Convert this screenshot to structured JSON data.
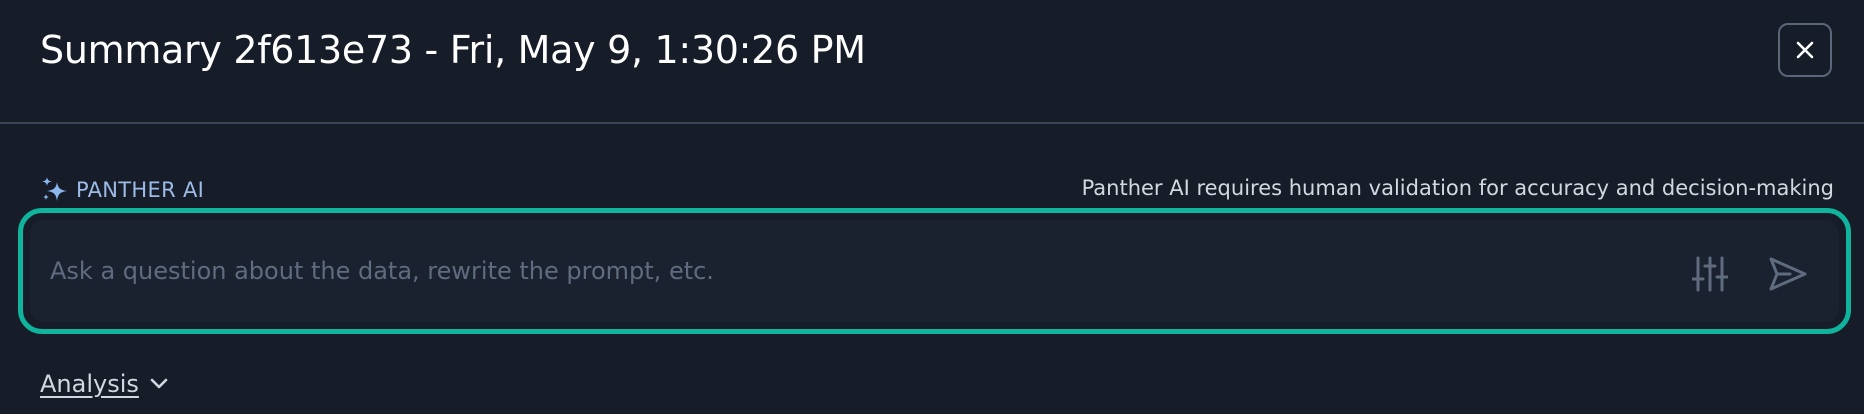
{
  "header": {
    "title": "Summary 2f613e73 - Fri, May 9, 1:30:26 PM",
    "close_icon": "close-icon"
  },
  "ai": {
    "label": "PANTHER AI",
    "icon": "sparkles-icon",
    "disclaimer": "Panther AI requires human validation for accuracy and decision-making"
  },
  "prompt": {
    "value": "",
    "placeholder": "Ask a question about the data, rewrite the prompt, etc.",
    "settings_icon": "sliders-icon",
    "send_icon": "send-icon"
  },
  "analysis": {
    "label": "Analysis",
    "icon": "chevron-down-icon"
  },
  "colors": {
    "background": "#161c28",
    "accent_border": "#10b39c",
    "ai_label": "#9cbbe6",
    "placeholder": "#5f6b7e"
  }
}
